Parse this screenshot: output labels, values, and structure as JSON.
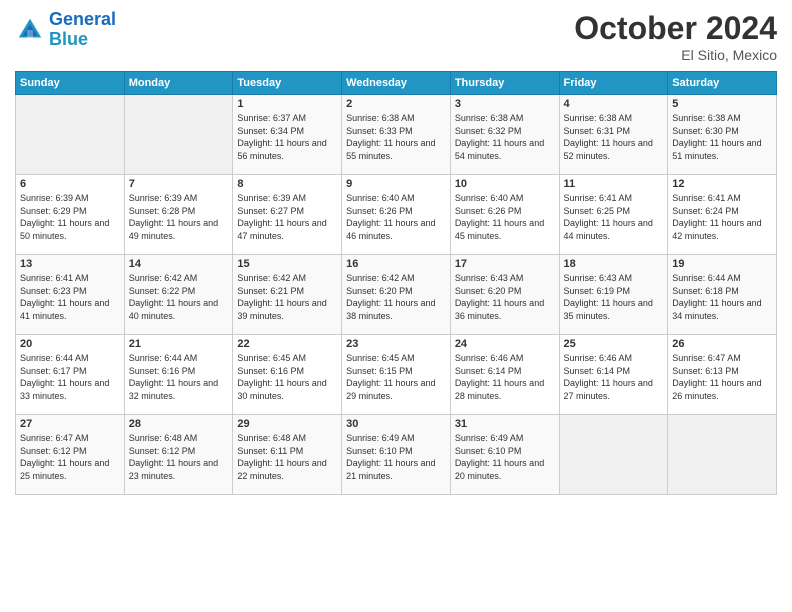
{
  "header": {
    "logo_line1": "General",
    "logo_line2": "Blue",
    "month": "October 2024",
    "location": "El Sitio, Mexico"
  },
  "weekdays": [
    "Sunday",
    "Monday",
    "Tuesday",
    "Wednesday",
    "Thursday",
    "Friday",
    "Saturday"
  ],
  "days": [
    {
      "num": "",
      "sunrise": "",
      "sunset": "",
      "daylight": "",
      "empty": true
    },
    {
      "num": "",
      "sunrise": "",
      "sunset": "",
      "daylight": "",
      "empty": true
    },
    {
      "num": "1",
      "sunrise": "Sunrise: 6:37 AM",
      "sunset": "Sunset: 6:34 PM",
      "daylight": "Daylight: 11 hours and 56 minutes."
    },
    {
      "num": "2",
      "sunrise": "Sunrise: 6:38 AM",
      "sunset": "Sunset: 6:33 PM",
      "daylight": "Daylight: 11 hours and 55 minutes."
    },
    {
      "num": "3",
      "sunrise": "Sunrise: 6:38 AM",
      "sunset": "Sunset: 6:32 PM",
      "daylight": "Daylight: 11 hours and 54 minutes."
    },
    {
      "num": "4",
      "sunrise": "Sunrise: 6:38 AM",
      "sunset": "Sunset: 6:31 PM",
      "daylight": "Daylight: 11 hours and 52 minutes."
    },
    {
      "num": "5",
      "sunrise": "Sunrise: 6:38 AM",
      "sunset": "Sunset: 6:30 PM",
      "daylight": "Daylight: 11 hours and 51 minutes."
    },
    {
      "num": "6",
      "sunrise": "Sunrise: 6:39 AM",
      "sunset": "Sunset: 6:29 PM",
      "daylight": "Daylight: 11 hours and 50 minutes."
    },
    {
      "num": "7",
      "sunrise": "Sunrise: 6:39 AM",
      "sunset": "Sunset: 6:28 PM",
      "daylight": "Daylight: 11 hours and 49 minutes."
    },
    {
      "num": "8",
      "sunrise": "Sunrise: 6:39 AM",
      "sunset": "Sunset: 6:27 PM",
      "daylight": "Daylight: 11 hours and 47 minutes."
    },
    {
      "num": "9",
      "sunrise": "Sunrise: 6:40 AM",
      "sunset": "Sunset: 6:26 PM",
      "daylight": "Daylight: 11 hours and 46 minutes."
    },
    {
      "num": "10",
      "sunrise": "Sunrise: 6:40 AM",
      "sunset": "Sunset: 6:26 PM",
      "daylight": "Daylight: 11 hours and 45 minutes."
    },
    {
      "num": "11",
      "sunrise": "Sunrise: 6:41 AM",
      "sunset": "Sunset: 6:25 PM",
      "daylight": "Daylight: 11 hours and 44 minutes."
    },
    {
      "num": "12",
      "sunrise": "Sunrise: 6:41 AM",
      "sunset": "Sunset: 6:24 PM",
      "daylight": "Daylight: 11 hours and 42 minutes."
    },
    {
      "num": "13",
      "sunrise": "Sunrise: 6:41 AM",
      "sunset": "Sunset: 6:23 PM",
      "daylight": "Daylight: 11 hours and 41 minutes."
    },
    {
      "num": "14",
      "sunrise": "Sunrise: 6:42 AM",
      "sunset": "Sunset: 6:22 PM",
      "daylight": "Daylight: 11 hours and 40 minutes."
    },
    {
      "num": "15",
      "sunrise": "Sunrise: 6:42 AM",
      "sunset": "Sunset: 6:21 PM",
      "daylight": "Daylight: 11 hours and 39 minutes."
    },
    {
      "num": "16",
      "sunrise": "Sunrise: 6:42 AM",
      "sunset": "Sunset: 6:20 PM",
      "daylight": "Daylight: 11 hours and 38 minutes."
    },
    {
      "num": "17",
      "sunrise": "Sunrise: 6:43 AM",
      "sunset": "Sunset: 6:20 PM",
      "daylight": "Daylight: 11 hours and 36 minutes."
    },
    {
      "num": "18",
      "sunrise": "Sunrise: 6:43 AM",
      "sunset": "Sunset: 6:19 PM",
      "daylight": "Daylight: 11 hours and 35 minutes."
    },
    {
      "num": "19",
      "sunrise": "Sunrise: 6:44 AM",
      "sunset": "Sunset: 6:18 PM",
      "daylight": "Daylight: 11 hours and 34 minutes."
    },
    {
      "num": "20",
      "sunrise": "Sunrise: 6:44 AM",
      "sunset": "Sunset: 6:17 PM",
      "daylight": "Daylight: 11 hours and 33 minutes."
    },
    {
      "num": "21",
      "sunrise": "Sunrise: 6:44 AM",
      "sunset": "Sunset: 6:16 PM",
      "daylight": "Daylight: 11 hours and 32 minutes."
    },
    {
      "num": "22",
      "sunrise": "Sunrise: 6:45 AM",
      "sunset": "Sunset: 6:16 PM",
      "daylight": "Daylight: 11 hours and 30 minutes."
    },
    {
      "num": "23",
      "sunrise": "Sunrise: 6:45 AM",
      "sunset": "Sunset: 6:15 PM",
      "daylight": "Daylight: 11 hours and 29 minutes."
    },
    {
      "num": "24",
      "sunrise": "Sunrise: 6:46 AM",
      "sunset": "Sunset: 6:14 PM",
      "daylight": "Daylight: 11 hours and 28 minutes."
    },
    {
      "num": "25",
      "sunrise": "Sunrise: 6:46 AM",
      "sunset": "Sunset: 6:14 PM",
      "daylight": "Daylight: 11 hours and 27 minutes."
    },
    {
      "num": "26",
      "sunrise": "Sunrise: 6:47 AM",
      "sunset": "Sunset: 6:13 PM",
      "daylight": "Daylight: 11 hours and 26 minutes."
    },
    {
      "num": "27",
      "sunrise": "Sunrise: 6:47 AM",
      "sunset": "Sunset: 6:12 PM",
      "daylight": "Daylight: 11 hours and 25 minutes."
    },
    {
      "num": "28",
      "sunrise": "Sunrise: 6:48 AM",
      "sunset": "Sunset: 6:12 PM",
      "daylight": "Daylight: 11 hours and 23 minutes."
    },
    {
      "num": "29",
      "sunrise": "Sunrise: 6:48 AM",
      "sunset": "Sunset: 6:11 PM",
      "daylight": "Daylight: 11 hours and 22 minutes."
    },
    {
      "num": "30",
      "sunrise": "Sunrise: 6:49 AM",
      "sunset": "Sunset: 6:10 PM",
      "daylight": "Daylight: 11 hours and 21 minutes."
    },
    {
      "num": "31",
      "sunrise": "Sunrise: 6:49 AM",
      "sunset": "Sunset: 6:10 PM",
      "daylight": "Daylight: 11 hours and 20 minutes."
    },
    {
      "num": "",
      "sunrise": "",
      "sunset": "",
      "daylight": "",
      "empty": true
    },
    {
      "num": "",
      "sunrise": "",
      "sunset": "",
      "daylight": "",
      "empty": true
    }
  ]
}
